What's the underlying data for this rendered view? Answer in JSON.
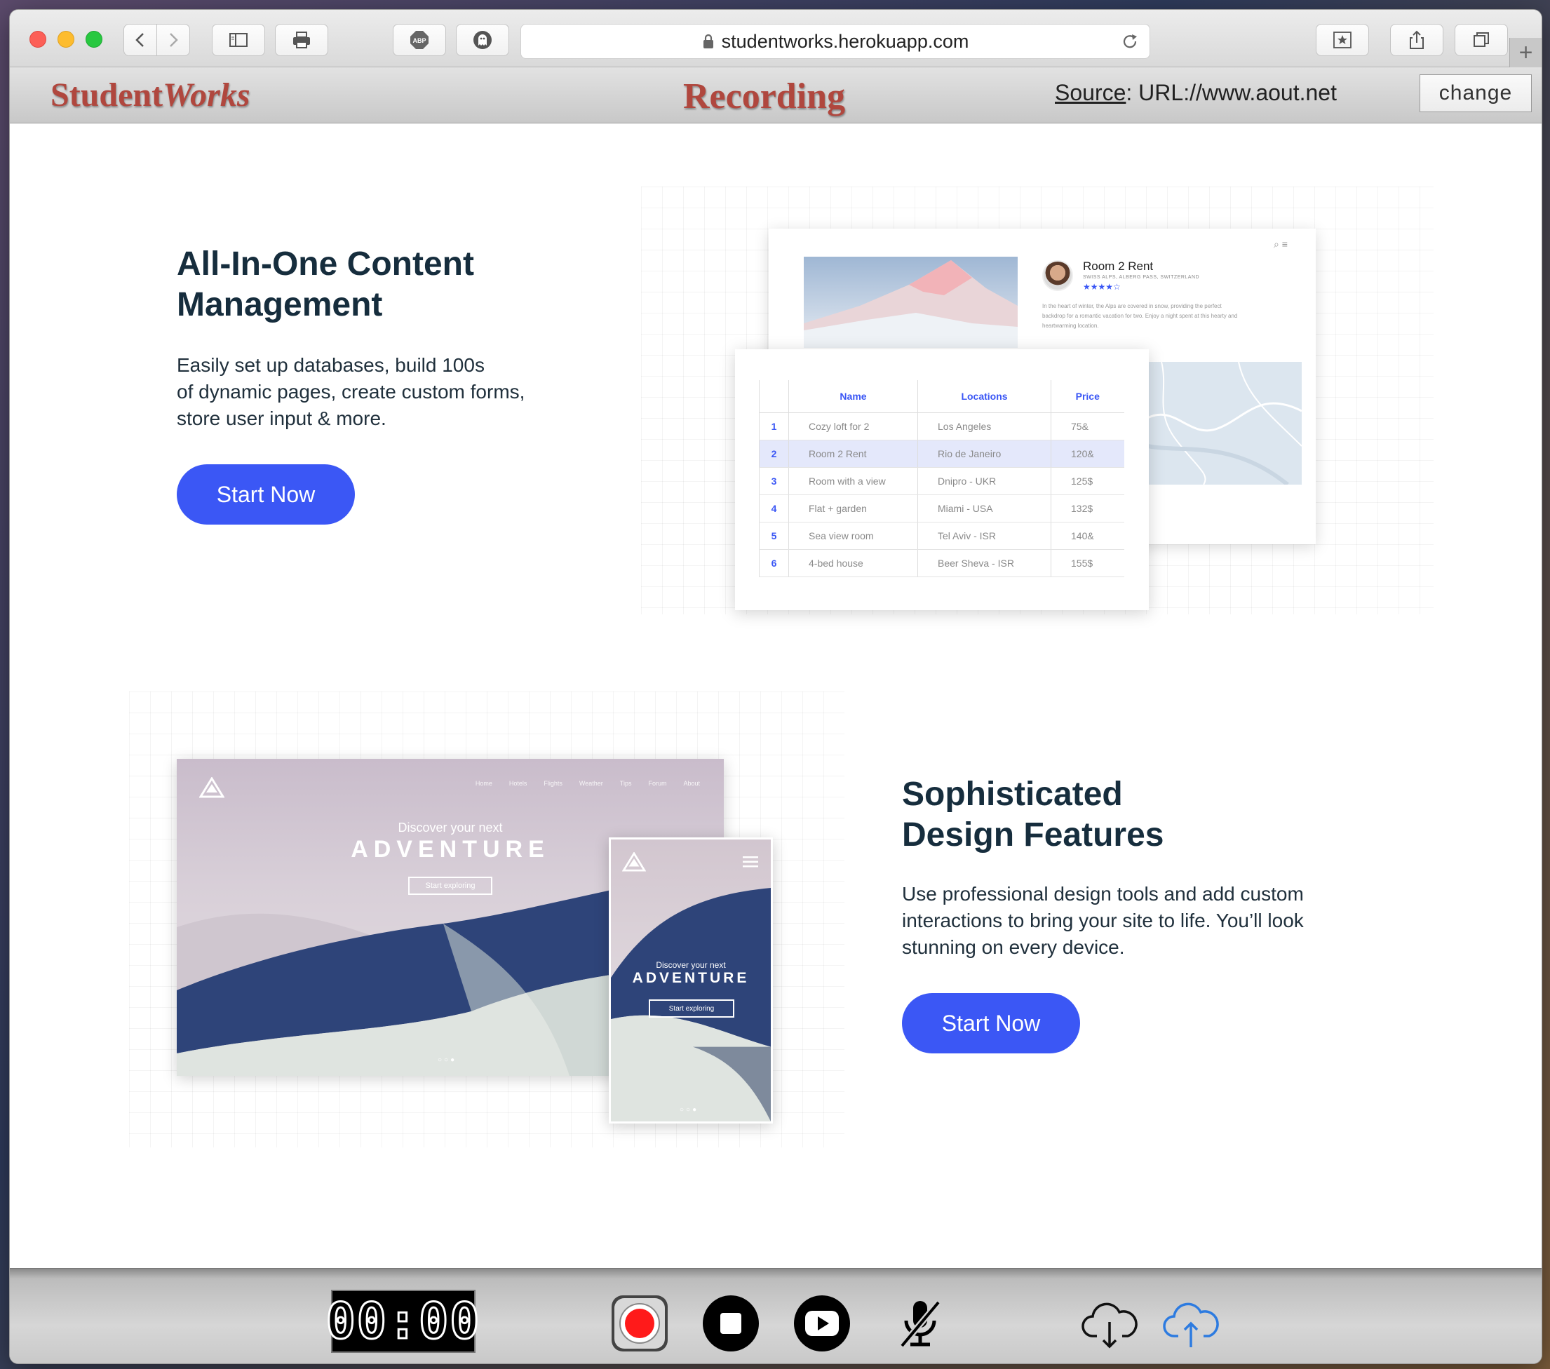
{
  "browser": {
    "url": "studentworks.herokuapp.com",
    "buttons": {
      "back": "back",
      "forward": "forward",
      "sidebar": "sidebar",
      "print": "print",
      "abp": "ABP",
      "ghostery": "ghostery",
      "bookmark": "bookmark",
      "share": "share",
      "tabs": "tabs"
    },
    "new_tab": "+"
  },
  "recorder_header": {
    "brand_part1": "Student",
    "brand_part2": "Works",
    "title": "Recording",
    "source_label": "Source",
    "source_value": ": URL://www.aout.net",
    "change_label": "change"
  },
  "section1": {
    "heading_line1": "All-In-One Content",
    "heading_line2": "Management",
    "desc_line1": "Easily set up databases, build 100s",
    "desc_line2": "of dynamic pages, create custom forms,",
    "desc_line3": "store user input & more.",
    "cta": "Start Now",
    "mock": {
      "room_title": "Room 2 Rent",
      "room_sub": "SWISS ALPS, ALBERG PASS, SWITZERLAND",
      "stars": "★★★★☆",
      "room_text": "In the heart of winter, the Alps are covered in snow, providing the perfect backdrop for a romantic vacation for two. Enjoy a night spent at this hearty and heartwarming location.",
      "table": {
        "headers": [
          "Name",
          "Locations",
          "Price"
        ],
        "rows": [
          {
            "n": "1",
            "name": "Cozy loft for 2",
            "loc": "Los Angeles",
            "price": "75&"
          },
          {
            "n": "2",
            "name": "Room 2 Rent",
            "loc": "Rio de Janeiro",
            "price": "120&"
          },
          {
            "n": "3",
            "name": "Room with a view",
            "loc": "Dnipro - UKR",
            "price": "125$"
          },
          {
            "n": "4",
            "name": "Flat + garden",
            "loc": "Miami - USA",
            "price": "132$"
          },
          {
            "n": "5",
            "name": "Sea view room",
            "loc": "Tel Aviv - ISR",
            "price": "140&"
          },
          {
            "n": "6",
            "name": "4-bed house",
            "loc": "Beer Sheva - ISR",
            "price": "155$"
          }
        ]
      }
    }
  },
  "section2": {
    "heading_line1": "Sophisticated",
    "heading_line2": "Design Features",
    "desc_line1": "Use professional design tools and add custom",
    "desc_line2": "interactions to bring your site to life. You’ll look",
    "desc_line3": "stunning on every device.",
    "cta": "Start Now",
    "mock": {
      "nav": [
        "Home",
        "Hotels",
        "Flights",
        "Weather",
        "Tips",
        "Forum",
        "About"
      ],
      "kicker": "Discover your next",
      "big": "ADVENTURE",
      "button": "Start exploring"
    }
  },
  "recorder_bar": {
    "timer": "00:00",
    "buttons": [
      "record",
      "stop",
      "play",
      "mic-muted",
      "cloud-download",
      "cloud-upload"
    ],
    "colors": {
      "record": "#ff1a1a",
      "upload": "#2d7be0"
    }
  }
}
